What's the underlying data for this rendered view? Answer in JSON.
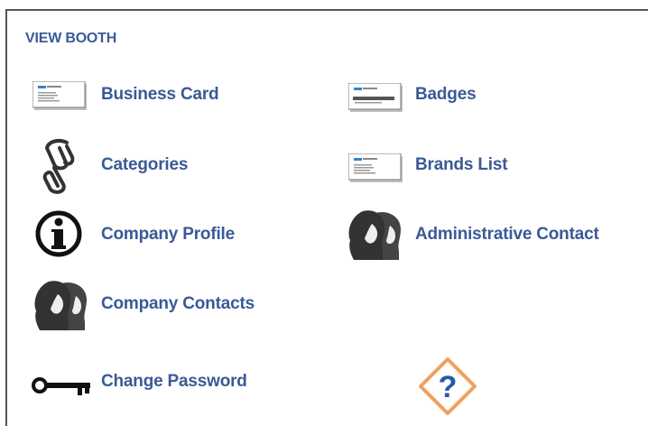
{
  "panel": {
    "title": "VIEW BOOTH"
  },
  "links": {
    "business_card": "Business Card",
    "badges": "Badges",
    "categories": "Categories",
    "brands_list": "Brands List",
    "company_profile": "Company Profile",
    "administrative_contact": "Administrative Contact",
    "company_contacts": "Company Contacts",
    "change_password": "Change Password"
  },
  "icons": {
    "business_card": "business-card-icon",
    "badges": "badge-icon",
    "categories": "paperclip-icon",
    "brands_list": "brand-card-icon",
    "company_profile": "info-icon",
    "administrative_contact": "people-icon",
    "company_contacts": "people-icon",
    "change_password": "key-icon",
    "help": "help-icon"
  },
  "colors": {
    "link": "#3a5a96",
    "help_diamond": "#f0a060",
    "help_mark": "#2a58a8"
  }
}
